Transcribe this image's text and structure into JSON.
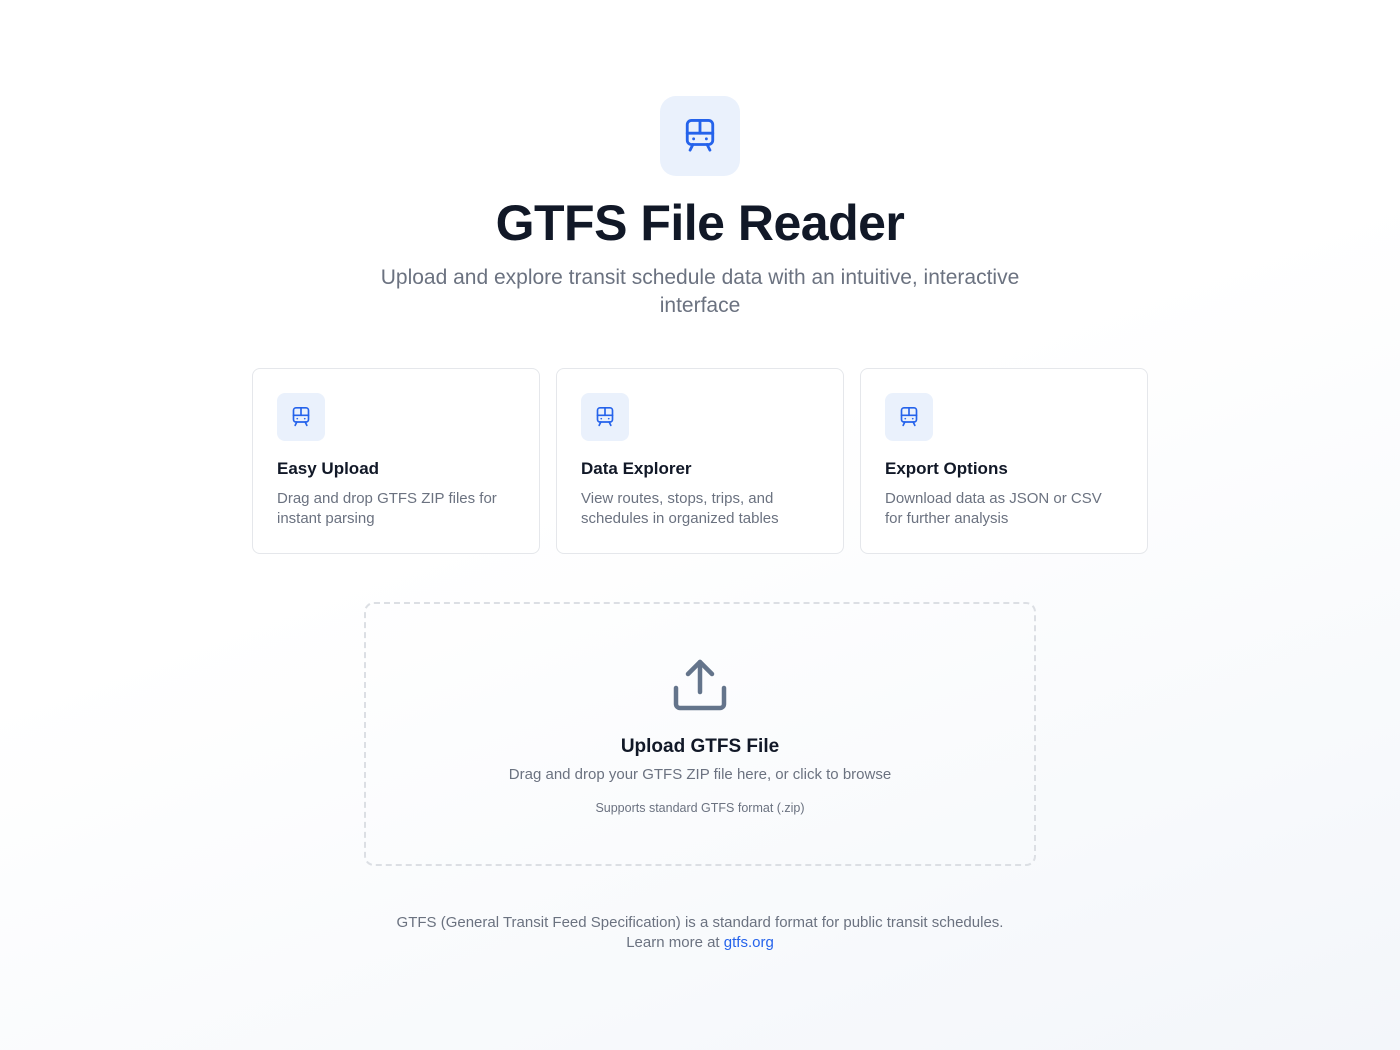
{
  "header": {
    "icon": "train-icon",
    "title": "GTFS File Reader",
    "subtitle": "Upload and explore transit schedule data with an intuitive, interactive interface"
  },
  "features": [
    {
      "icon": "train-icon",
      "title": "Easy Upload",
      "description": "Drag and drop GTFS ZIP files for instant parsing"
    },
    {
      "icon": "train-icon",
      "title": "Data Explorer",
      "description": "View routes, stops, trips, and schedules in organized tables"
    },
    {
      "icon": "train-icon",
      "title": "Export Options",
      "description": "Download data as JSON or CSV for further analysis"
    }
  ],
  "upload": {
    "icon": "upload-icon",
    "title": "Upload GTFS File",
    "description": "Drag and drop your GTFS ZIP file here, or click to browse",
    "note": "Supports standard GTFS format (.zip)"
  },
  "footer": {
    "text": "GTFS (General Transit Feed Specification) is a standard format for public transit schedules.",
    "learn_more": "Learn more at",
    "link_text": "gtfs.org"
  },
  "colors": {
    "accent": "#2563eb",
    "icon_bg": "#eaf1fc",
    "text_primary": "#111827",
    "text_muted": "#6b7280"
  }
}
